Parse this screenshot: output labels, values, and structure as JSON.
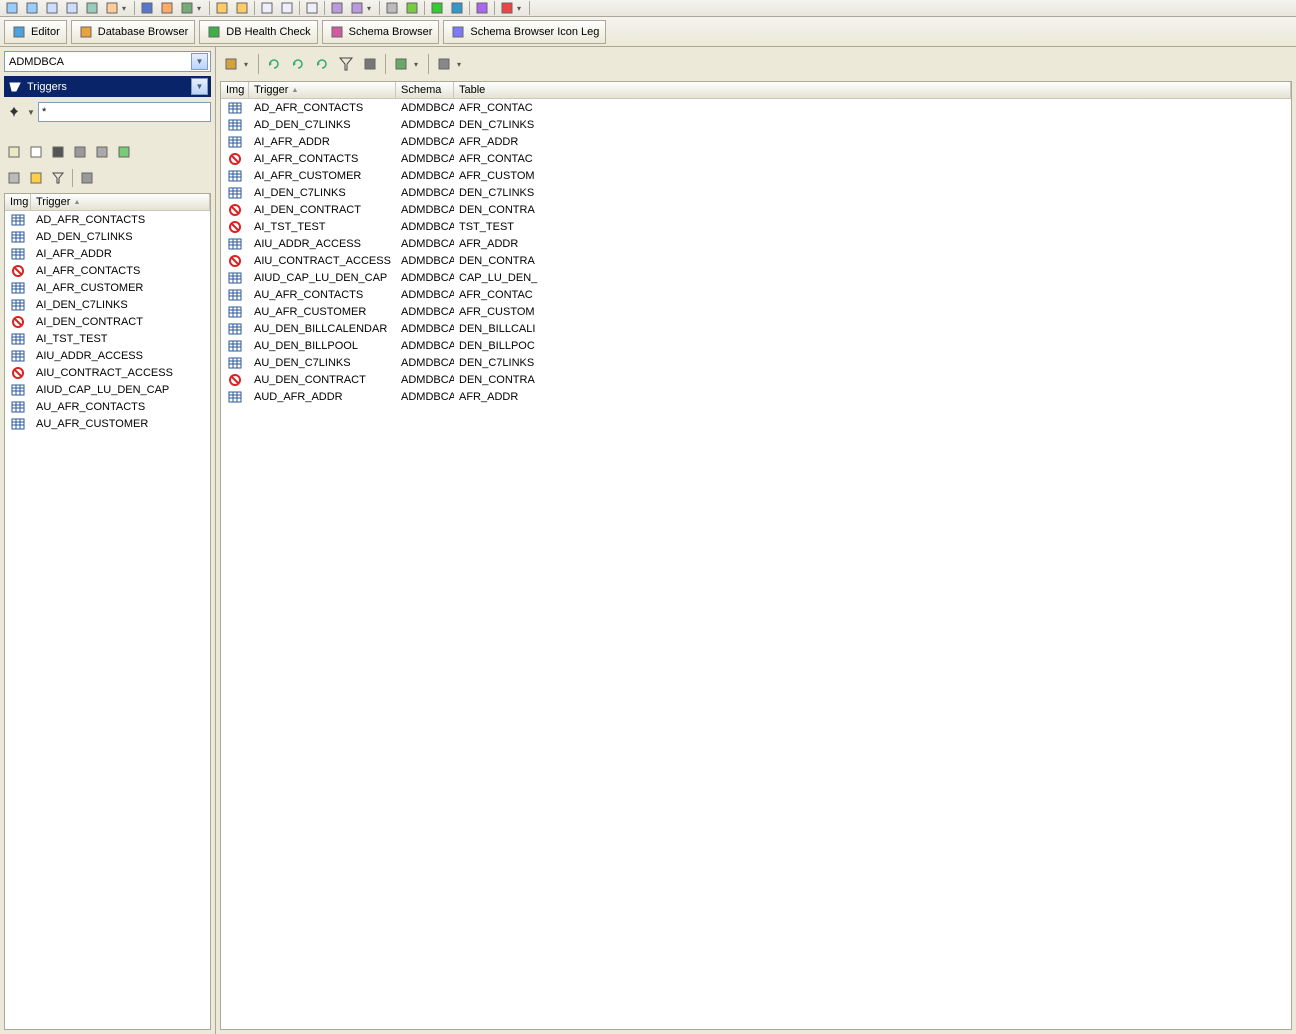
{
  "topToolbar": {
    "icons": [
      "db",
      "copy-db",
      "binoculars",
      "binoculars-sql",
      "sql",
      "sql-run",
      "diamond",
      "calendar",
      "gear",
      "wand",
      "hourglass",
      "page",
      "page-copy",
      "doc",
      "doc-plus",
      "arrow-left",
      "arrow-right",
      "stop",
      "bug",
      "down-green",
      "down-blue",
      "wand2",
      "close"
    ]
  },
  "tabs": [
    {
      "icon": "editor",
      "label": "Editor"
    },
    {
      "icon": "db-browser",
      "label": "Database Browser"
    },
    {
      "icon": "db-health",
      "label": "DB Health Check"
    },
    {
      "icon": "schema",
      "label": "Schema Browser"
    },
    {
      "icon": "schema-icon",
      "label": "Schema Browser Icon Leg"
    }
  ],
  "left": {
    "schemaCombo": "ADMDBCA",
    "objectTypeCombo": "Triggers",
    "filterValue": "*",
    "miniBar1": [
      "pushpin",
      "dropdown"
    ],
    "miniBar2": [
      "new-window",
      "new-doc",
      "stop",
      "print",
      "copy",
      "run"
    ],
    "miniBar3": [
      "hand",
      "lightbulb",
      "funnel",
      "split"
    ],
    "listHeader": {
      "img": "Img",
      "trigger": "Trigger"
    },
    "rows": [
      {
        "icon": "grid",
        "name": "AD_AFR_CONTACTS"
      },
      {
        "icon": "grid",
        "name": "AD_DEN_C7LINKS"
      },
      {
        "icon": "grid",
        "name": "AI_AFR_ADDR"
      },
      {
        "icon": "disabled",
        "name": "AI_AFR_CONTACTS"
      },
      {
        "icon": "grid",
        "name": "AI_AFR_CUSTOMER"
      },
      {
        "icon": "grid",
        "name": "AI_DEN_C7LINKS"
      },
      {
        "icon": "disabled",
        "name": "AI_DEN_CONTRACT"
      },
      {
        "icon": "grid",
        "name": "AI_TST_TEST"
      },
      {
        "icon": "grid",
        "name": "AIU_ADDR_ACCESS"
      },
      {
        "icon": "disabled",
        "name": "AIU_CONTRACT_ACCESS"
      },
      {
        "icon": "grid",
        "name": "AIUD_CAP_LU_DEN_CAP"
      },
      {
        "icon": "grid",
        "name": "AU_AFR_CONTACTS"
      },
      {
        "icon": "grid",
        "name": "AU_AFR_CUSTOMER"
      }
    ]
  },
  "right": {
    "toolbarIcons": [
      "globe",
      "refresh1",
      "refresh2",
      "refresh3",
      "funnel",
      "form",
      "tree",
      "graph"
    ],
    "gridHeader": {
      "img": "Img",
      "trigger": "Trigger",
      "schema": "Schema",
      "table": "Table"
    },
    "rows": [
      {
        "icon": "grid",
        "trigger": "AD_AFR_CONTACTS",
        "schema": "ADMDBCA",
        "table": "AFR_CONTAC"
      },
      {
        "icon": "grid",
        "trigger": "AD_DEN_C7LINKS",
        "schema": "ADMDBCA",
        "table": "DEN_C7LINKS"
      },
      {
        "icon": "grid",
        "trigger": "AI_AFR_ADDR",
        "schema": "ADMDBCA",
        "table": "AFR_ADDR"
      },
      {
        "icon": "disabled",
        "trigger": "AI_AFR_CONTACTS",
        "schema": "ADMDBCA",
        "table": "AFR_CONTAC"
      },
      {
        "icon": "grid",
        "trigger": "AI_AFR_CUSTOMER",
        "schema": "ADMDBCA",
        "table": "AFR_CUSTOM"
      },
      {
        "icon": "grid",
        "trigger": "AI_DEN_C7LINKS",
        "schema": "ADMDBCA",
        "table": "DEN_C7LINKS"
      },
      {
        "icon": "disabled",
        "trigger": "AI_DEN_CONTRACT",
        "schema": "ADMDBCA",
        "table": "DEN_CONTRA"
      },
      {
        "icon": "disabled",
        "trigger": "AI_TST_TEST",
        "schema": "ADMDBCA",
        "table": "TST_TEST"
      },
      {
        "icon": "grid",
        "trigger": "AIU_ADDR_ACCESS",
        "schema": "ADMDBCA",
        "table": "AFR_ADDR"
      },
      {
        "icon": "disabled",
        "trigger": "AIU_CONTRACT_ACCESS",
        "schema": "ADMDBCA",
        "table": "DEN_CONTRA"
      },
      {
        "icon": "grid",
        "trigger": "AIUD_CAP_LU_DEN_CAP",
        "schema": "ADMDBCA",
        "table": "CAP_LU_DEN_"
      },
      {
        "icon": "grid",
        "trigger": "AU_AFR_CONTACTS",
        "schema": "ADMDBCA",
        "table": "AFR_CONTAC"
      },
      {
        "icon": "grid",
        "trigger": "AU_AFR_CUSTOMER",
        "schema": "ADMDBCA",
        "table": "AFR_CUSTOM"
      },
      {
        "icon": "grid",
        "trigger": "AU_DEN_BILLCALENDAR",
        "schema": "ADMDBCA",
        "table": "DEN_BILLCALI"
      },
      {
        "icon": "grid",
        "trigger": "AU_DEN_BILLPOOL",
        "schema": "ADMDBCA",
        "table": "DEN_BILLPOC"
      },
      {
        "icon": "grid",
        "trigger": "AU_DEN_C7LINKS",
        "schema": "ADMDBCA",
        "table": "DEN_C7LINKS"
      },
      {
        "icon": "disabled",
        "trigger": "AU_DEN_CONTRACT",
        "schema": "ADMDBCA",
        "table": "DEN_CONTRA"
      },
      {
        "icon": "grid",
        "trigger": "AUD_AFR_ADDR",
        "schema": "ADMDBCA",
        "table": "AFR_ADDR"
      }
    ]
  }
}
